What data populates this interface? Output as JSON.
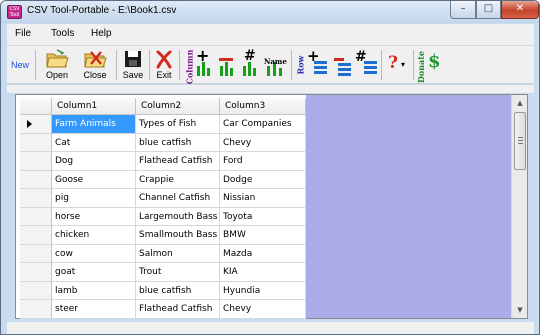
{
  "window": {
    "title": "CSV Tool-Portable - E:\\Book1.csv",
    "app_icon_text": "CSV Tool",
    "minimize_glyph": "–",
    "maximize_glyph": "□",
    "close_glyph": "✕"
  },
  "menu": [
    "File",
    "Tools",
    "Help"
  ],
  "toolbar": {
    "new_label": "New",
    "open_label": "Open",
    "close_label": "Close",
    "save_label": "Save",
    "exit_label": "Exit",
    "column_label": "Column",
    "name_label": "Name",
    "row_label": "Row",
    "donate_label": "Donate",
    "help_glyph": "?",
    "dropdown_glyph": "▾",
    "dollar_glyph": "$",
    "hash_glyph": "#",
    "plus_glyph": "+",
    "minus_glyph": "−"
  },
  "grid": {
    "columns": [
      "Column1",
      "Column2",
      "Column3"
    ],
    "rows": [
      [
        "Farm Animals",
        "Types of Fish",
        "Car Companies"
      ],
      [
        "Cat",
        "blue catfish",
        "Chevy"
      ],
      [
        "Dog",
        "Flathead Catfish",
        "Ford"
      ],
      [
        "Goose",
        "Crappie",
        "Dodge"
      ],
      [
        "pig",
        "Channel Catfish",
        "Nissian"
      ],
      [
        "horse",
        "Largemouth Bass",
        "Toyota"
      ],
      [
        "chicken",
        "Smallmouth Bass",
        "BMW"
      ],
      [
        "cow",
        "Salmon",
        "Mazda"
      ],
      [
        "goat",
        "Trout",
        "KIA"
      ],
      [
        "lamb",
        "blue catfish",
        "Hyundia"
      ],
      [
        "steer",
        "Flathead Catfish",
        "Chevy"
      ]
    ],
    "selected_cell": "Farm Animals",
    "current_row": 0
  },
  "scrollbar": {
    "up_glyph": "▲",
    "down_glyph": "▼"
  },
  "colors": {
    "selection": "#3399ff",
    "grid_background": "#a9ace6",
    "title_bar": "#c9dcef"
  }
}
